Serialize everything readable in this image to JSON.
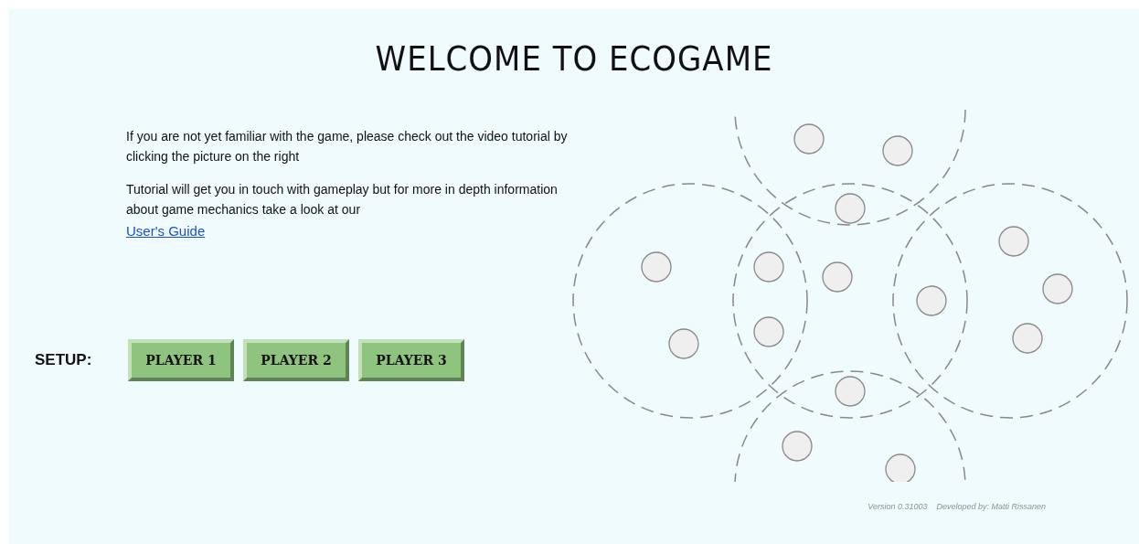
{
  "title": "WELCOME TO ECOGAME",
  "intro": [
    "If you are not yet familiar with the game, please check out the video tutorial by clicking the picture on the right",
    "Tutorial will get you in touch with gameplay but for more in depth information about game mechanics take a look at our"
  ],
  "guide_link": "User's Guide",
  "setup": {
    "label": "SETUP:",
    "buttons": [
      "PLAYER 1",
      "PLAYER 2",
      "PLAYER 3"
    ]
  },
  "footer": {
    "version": "Version 0.31003",
    "credits": "Developed by: Matti Rissanen"
  }
}
